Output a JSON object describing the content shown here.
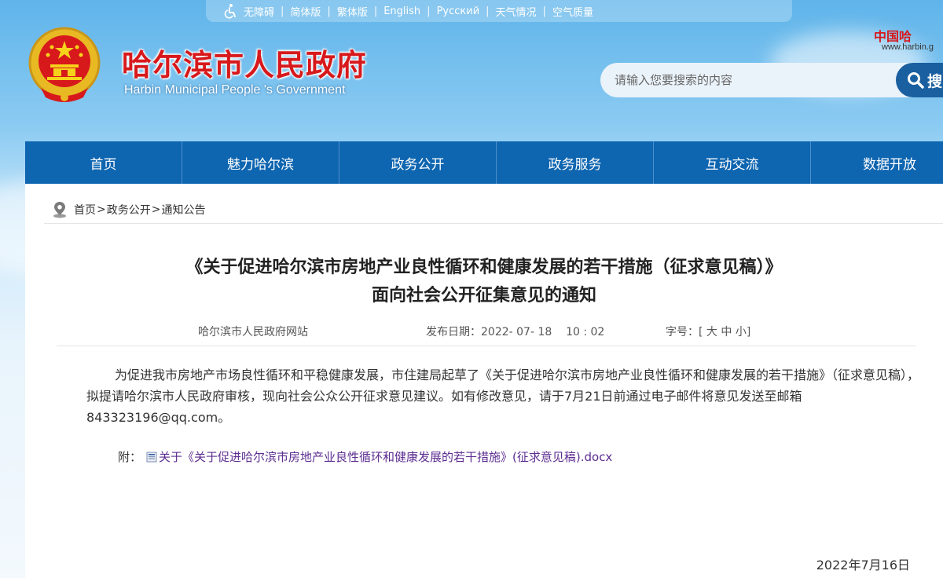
{
  "topbar": {
    "links": [
      "无障碍",
      "简体版",
      "繁体版",
      "English",
      "Русский",
      "天气情况",
      "空气质量"
    ]
  },
  "header": {
    "title": "哈尔滨市人民政府",
    "subtitle": "Harbin Municipal People 's Government",
    "logo_mark": "中国哈",
    "logo_url": "www.harbin.g"
  },
  "search": {
    "placeholder": "请输入您要搜索的内容",
    "button_label": "搜"
  },
  "nav": {
    "items": [
      "首页",
      "魅力哈尔滨",
      "政务公开",
      "政务服务",
      "互动交流",
      "数据开放"
    ]
  },
  "breadcrumb": {
    "items": [
      "首页",
      "政务公开",
      "通知公告"
    ],
    "separator": ">"
  },
  "article": {
    "title_line1": "《关于促进哈尔滨市房地产业良性循环和健康发展的若干措施（征求意见稿）》",
    "title_line2": "面向社会公开征集意见的通知",
    "source": "哈尔滨市人民政府网站",
    "publish_label": "发布日期：",
    "publish_date": "2022- 07- 18    10 : 02",
    "font_size_label": "字号：",
    "font_size_open": "[",
    "font_size_options": [
      "大",
      "中",
      "小"
    ],
    "font_size_close": "]",
    "body": "为促进我市房地产市场良性循环和平稳健康发展，市住建局起草了《关于促进哈尔滨市房地产业良性循环和健康发展的若干措施》（征求意见稿），拟提请哈尔滨市人民政府审核，现向社会公众公开征求意见建议。如有修改意见，请于7月21日前通过电子邮件将意见发送至邮箱843323196@qq.com。",
    "attachment_label": "附：",
    "attachment_name": "关于《关于促进哈尔滨市房地产业良性循环和健康发展的若干措施》(征求意见稿).docx",
    "date": "2022年7月16日"
  },
  "colors": {
    "nav_blue": "#0e65b0",
    "title_red": "#d7191c",
    "link_purple": "#5c2d91"
  }
}
